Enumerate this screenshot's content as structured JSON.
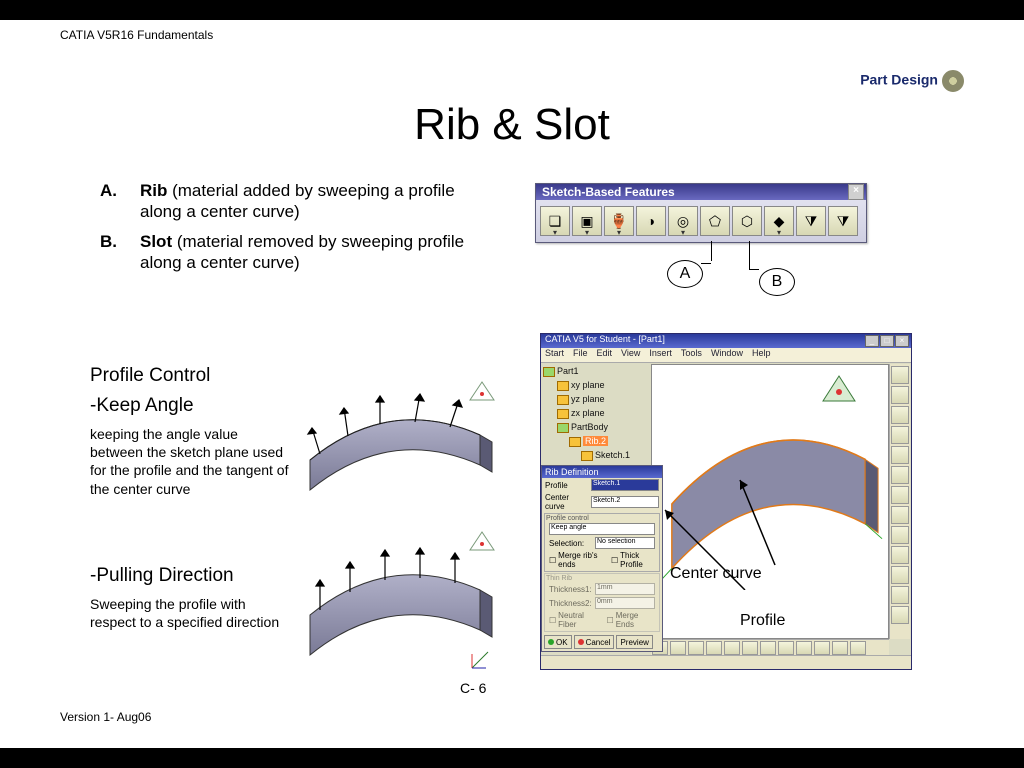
{
  "header": "CATIA V5R16 Fundamentals",
  "brand": "Part Design",
  "title": "Rib & Slot",
  "defs": {
    "a_label": "A.",
    "a_bold": "Rib",
    "a_rest": " (material added by sweeping a profile along a center curve)",
    "b_label": "B.",
    "b_bold": "Slot",
    "b_rest": " (material removed by sweeping profile along a center curve)"
  },
  "profile_control_h": "Profile Control",
  "keep_angle_h": "-Keep Angle",
  "keep_angle_b": "keeping the angle value between the sketch plane used for the profile and the tangent of the center curve",
  "pulling_h": "-Pulling Direction",
  "pulling_b": "Sweeping the profile with respect to a specified direction",
  "page_num": "C- 6",
  "version": "Version 1- Aug06",
  "toolbar": {
    "title": "Sketch-Based Features",
    "callout_a": "A",
    "callout_b": "B"
  },
  "catia_win": {
    "title": "CATIA V5 for Student - [Part1]",
    "menu": [
      "Start",
      "File",
      "Edit",
      "View",
      "Insert",
      "Tools",
      "Window",
      "Help"
    ],
    "tree": {
      "root": "Part1",
      "planes": [
        "xy plane",
        "yz plane",
        "zx plane"
      ],
      "body": "PartBody",
      "rib": "Rib.2",
      "sketches": [
        "Sketch.1",
        "Sketch.2"
      ]
    },
    "dialog": {
      "title": "Rib Definition",
      "profile_lab": "Profile",
      "profile_val": "Sketch.1",
      "curve_lab": "Center curve",
      "curve_val": "Sketch.2",
      "grp": "Profile control",
      "keep": "Keep angle",
      "sel_lab": "Selection:",
      "sel_val": "No selection",
      "chk1": "Merge rib's ends",
      "chk2": "Thick Profile",
      "thin_grp": "Thin Rib",
      "t1_lab": "Thickness1:",
      "t1_val": "1mm",
      "t2_lab": "Thickness2:",
      "t2_val": "0mm",
      "chk3": "Neutral Fiber",
      "chk4": "Merge Ends",
      "ok": "OK",
      "cancel": "Cancel",
      "preview": "Preview"
    },
    "ann_center": "Center curve",
    "ann_profile": "Profile"
  }
}
